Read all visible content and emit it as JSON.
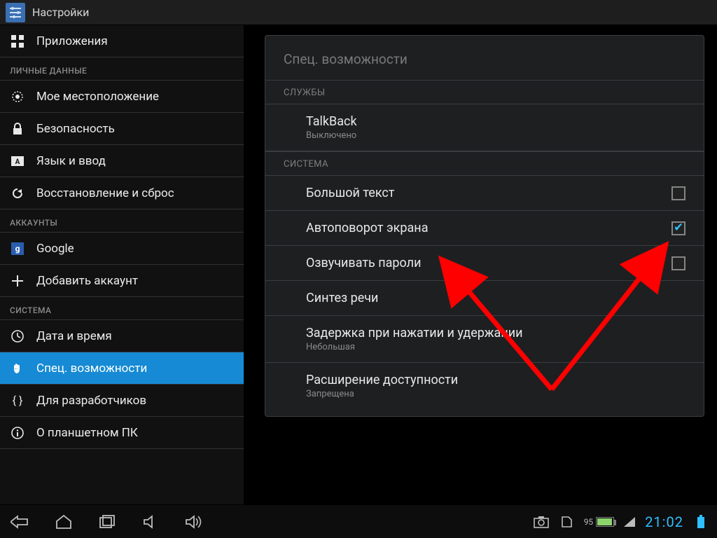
{
  "header": {
    "title": "Настройки"
  },
  "sidebar": {
    "items_top": [
      {
        "id": "apps",
        "label": "Приложения",
        "icon": "apps-icon"
      }
    ],
    "section_personal": "ЛИЧНЫЕ ДАННЫЕ",
    "items_personal": [
      {
        "id": "location",
        "label": "Мое местоположение",
        "icon": "location-icon"
      },
      {
        "id": "security",
        "label": "Безопасность",
        "icon": "lock-icon"
      },
      {
        "id": "lang",
        "label": "Язык и ввод",
        "icon": "keyboard-icon"
      },
      {
        "id": "backup",
        "label": "Восстановление и сброс",
        "icon": "refresh-icon"
      }
    ],
    "section_accounts": "АККАУНТЫ",
    "items_accounts": [
      {
        "id": "google",
        "label": "Google",
        "icon": "google-icon"
      },
      {
        "id": "addacct",
        "label": "Добавить аккаунт",
        "icon": "plus-icon"
      }
    ],
    "section_system": "СИСТЕМА",
    "items_system": [
      {
        "id": "datetime",
        "label": "Дата и время",
        "icon": "clock-icon"
      },
      {
        "id": "a11y",
        "label": "Спец. возможности",
        "icon": "hand-icon",
        "active": true
      },
      {
        "id": "dev",
        "label": "Для разработчиков",
        "icon": "braces-icon"
      },
      {
        "id": "about",
        "label": "О планшетном ПК",
        "icon": "info-icon"
      }
    ]
  },
  "panel": {
    "title": "Спец. возможности",
    "group_services": "СЛУЖБЫ",
    "talkback": {
      "label": "TalkBack",
      "status": "Выключено"
    },
    "group_system": "СИСТЕМА",
    "rows": {
      "large_text": {
        "label": "Большой текст",
        "checked": false
      },
      "auto_rotate": {
        "label": "Автоповорот экрана",
        "checked": true
      },
      "speak_pw": {
        "label": "Озвучивать пароли",
        "checked": false
      },
      "tts": {
        "label": "Синтез речи"
      },
      "touch_hold": {
        "label": "Задержка при нажатии и удержании",
        "sub": "Небольшая"
      },
      "a11y_ext": {
        "label": "Расширение доступности",
        "sub": "Запрещена"
      }
    }
  },
  "navbar": {
    "battery_pct": "95",
    "clock": "21:02"
  },
  "annotation": {
    "color": "#ff0000"
  }
}
